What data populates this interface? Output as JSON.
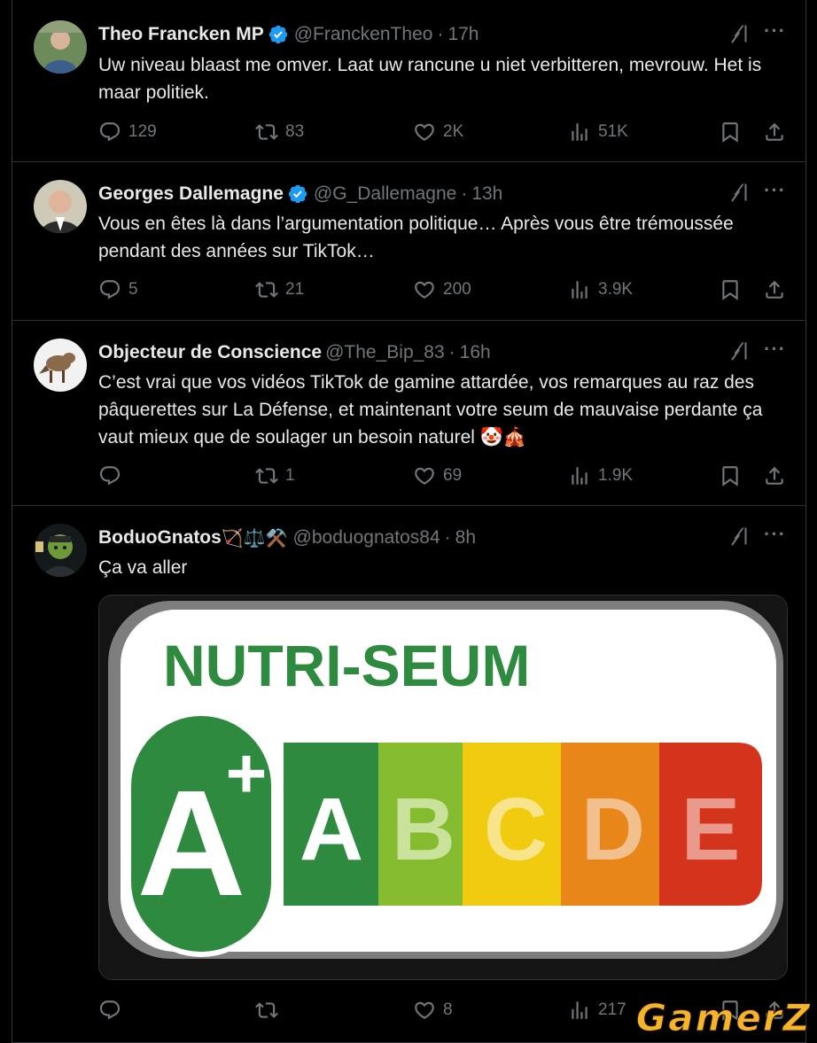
{
  "tweets": [
    {
      "name": "Theo Francken MP",
      "verified": true,
      "handle": "@FranckenTheo",
      "time": "17h",
      "text": "Uw niveau blaast me omver. Laat uw rancune u niet verbitteren, mevrouw. Het is maar politiek.",
      "replies": "129",
      "retweets": "83",
      "likes": "2K",
      "views": "51K"
    },
    {
      "name": "Georges Dallemagne",
      "verified": true,
      "handle": "@G_Dallemagne",
      "time": "13h",
      "text": "Vous en êtes là dans l’argumentation politique… Après vous être trémoussée pendant des années sur TikTok…",
      "replies": "5",
      "retweets": "21",
      "likes": "200",
      "views": "3.9K"
    },
    {
      "name": "Objecteur de Conscience",
      "verified": false,
      "handle": "@The_Bip_83",
      "time": "16h",
      "text": "C’est vrai que vos vidéos TikTok de gamine attardée, vos remarques au raz des pâquerettes sur La Défense, et maintenant votre seum de mauvaise perdante ça vaut mieux que de soulager un besoin naturel 🤡🎪",
      "replies": "",
      "retweets": "1",
      "likes": "69",
      "views": "1.9K"
    },
    {
      "name": "BoduoGnatos",
      "name_emojis": "🏹⚖️⚒️",
      "verified": false,
      "handle": "@boduognatos84",
      "time": "8h",
      "text": "Ça va aller",
      "replies": "",
      "retweets": "",
      "likes": "8",
      "views": "217"
    }
  ],
  "media": {
    "title": "NUTRI-SEUM",
    "big_grade": "A",
    "plus": "+",
    "grades": [
      "A",
      "B",
      "C",
      "D",
      "E"
    ],
    "grade_colors": [
      "#2e8a3e",
      "#84bb2f",
      "#f1cb10",
      "#e8861a",
      "#d4331c"
    ],
    "title_color": "#2e8a3e"
  },
  "watermark": "GamerZ",
  "colors": {
    "verified": "#1d9bf0",
    "muted": "#71767b",
    "text": "#e7e9ea",
    "border": "#2f3336"
  }
}
